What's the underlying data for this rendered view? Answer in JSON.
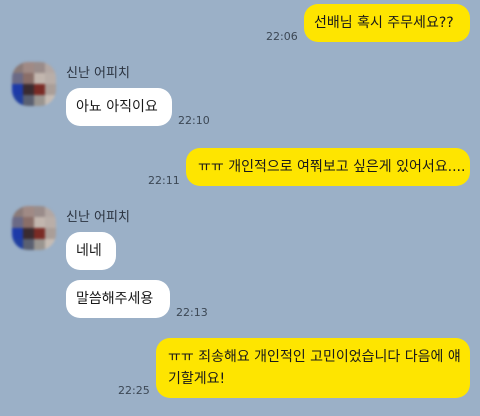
{
  "messages": [
    {
      "side": "right",
      "text": "선배님 혹시 주무세요??",
      "time": "22:06"
    },
    {
      "side": "left",
      "sender": "신난 어피치",
      "text": "아뇨 아직이요",
      "time": "22:10"
    },
    {
      "side": "right",
      "text": "ㅠㅠ 개인적으로 여쭤보고 싶은게 있어서요....",
      "time": "22:11"
    },
    {
      "side": "left",
      "sender": "신난 어피치",
      "text": "네네"
    },
    {
      "side": "left",
      "text": "말씀해주세용",
      "time": "22:13"
    },
    {
      "side": "right",
      "text_line1": "ㅠㅠ 죄송해요 개인적인 고민이었습니다 다음에 얘",
      "text_line2": "기할게요!",
      "time": "22:25"
    }
  ],
  "colors": {
    "background": "#9bb0c7",
    "my_bubble": "#fee500",
    "their_bubble": "#ffffff"
  },
  "icons": {
    "avatar": "pixelated-profile-avatar"
  }
}
